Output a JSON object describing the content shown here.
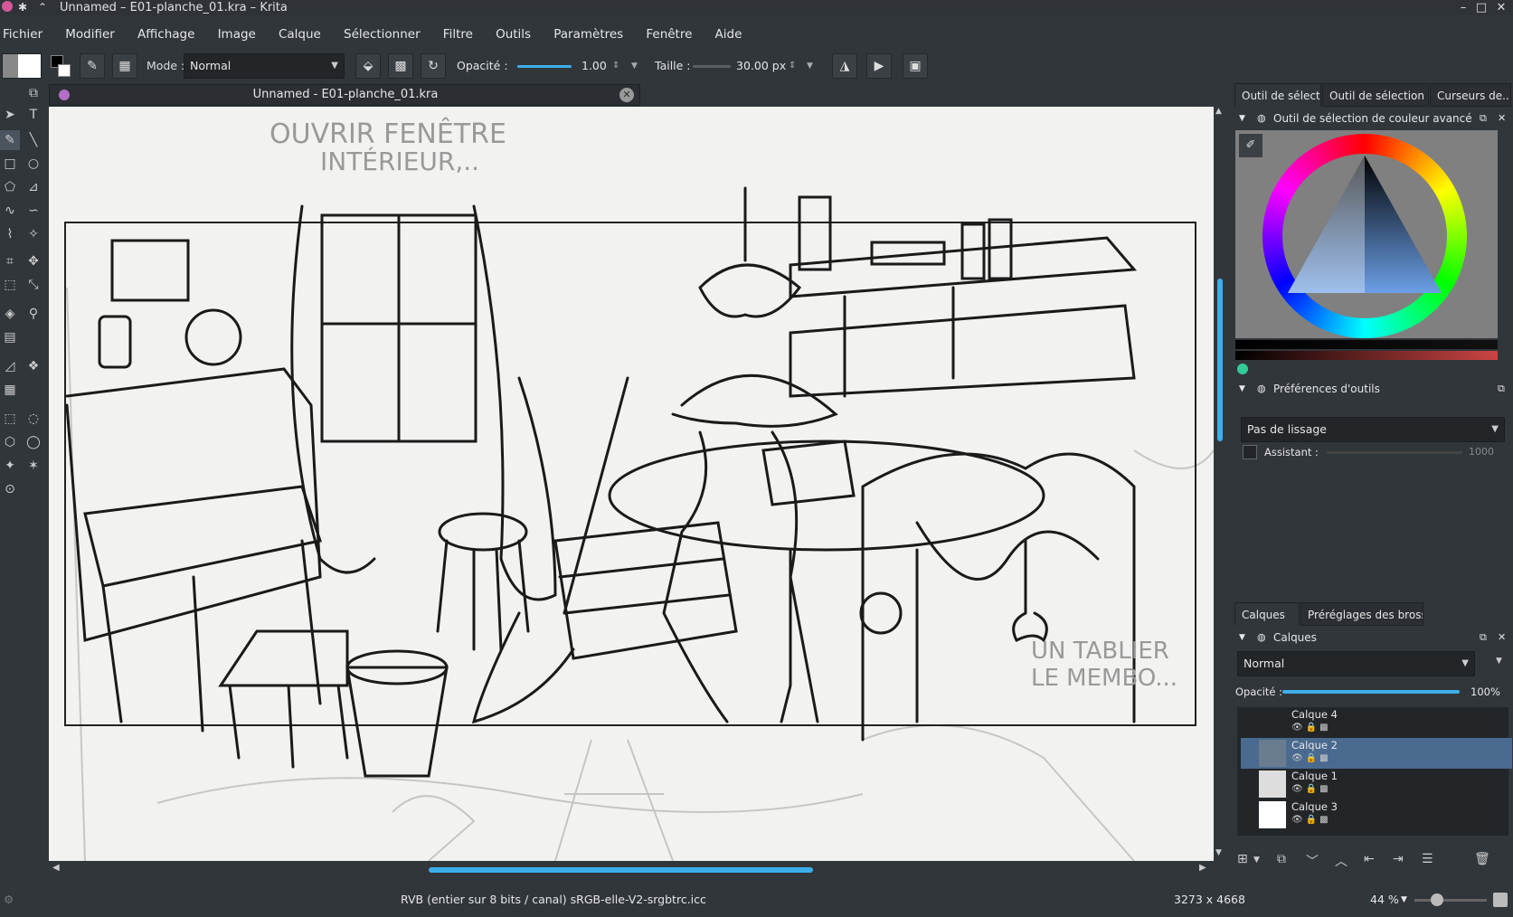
{
  "window": {
    "title": "Unnamed – E01-planche_01.kra – Krita",
    "buttons": {
      "minimize": "–",
      "maximize": "□",
      "close": "✕"
    }
  },
  "menu": [
    "Fichier",
    "Modifier",
    "Affichage",
    "Image",
    "Calque",
    "Sélectionner",
    "Filtre",
    "Outils",
    "Paramètres",
    "Fenêtre",
    "Aide"
  ],
  "tool_options": {
    "mode_label": "Mode :",
    "mode_value": "Normal",
    "opacity_label": "Opacité :",
    "opacity_value": "1.00",
    "opacity_fraction": 1.0,
    "size_label": "Taille :",
    "size_value": "30.00 px",
    "size_fraction": 0.06
  },
  "document": {
    "tab_title": "Unnamed - E01-planche_01.kra",
    "sketch_text_top_1": "OUVRIR FENÊTRE",
    "sketch_text_top_2": "INTÉRIEUR,..",
    "sketch_text_right_1": "UN TABLIER",
    "sketch_text_right_2": "LE MEMBO..."
  },
  "panels": {
    "top_tabs": [
      "Outil de sélecti...",
      "Outil de sélection d'u...",
      "Curseurs de..."
    ],
    "color_selector_title": "Outil de sélection de couleur avancé",
    "tool_prefs_title": "Préférences d'outils",
    "smoothing_value": "Pas de lissage",
    "assistant_label": "Assistant :",
    "assistant_value": "1000",
    "bottom_tabs": [
      "Calques",
      "Préréglages des brosses"
    ],
    "layers_title": "Calques",
    "blend_mode": "Normal",
    "layer_opacity_label": "Opacité :",
    "layer_opacity_value": "100%",
    "layers": [
      {
        "name": "Calque 4",
        "selected": false
      },
      {
        "name": "Calque 2",
        "selected": true
      },
      {
        "name": "Calque 1",
        "selected": false
      },
      {
        "name": "Calque 3",
        "selected": false
      }
    ]
  },
  "status": {
    "colorspace": "RVB (entier sur 8 bits / canal)  sRGB-elle-V2-srgbtrc.icc",
    "dimensions": "3273 x 4668",
    "zoom": "44 %"
  },
  "colors": {
    "accent": "#3daee9",
    "bg": "#31363b",
    "selected_layer": "#4a6a8f"
  }
}
